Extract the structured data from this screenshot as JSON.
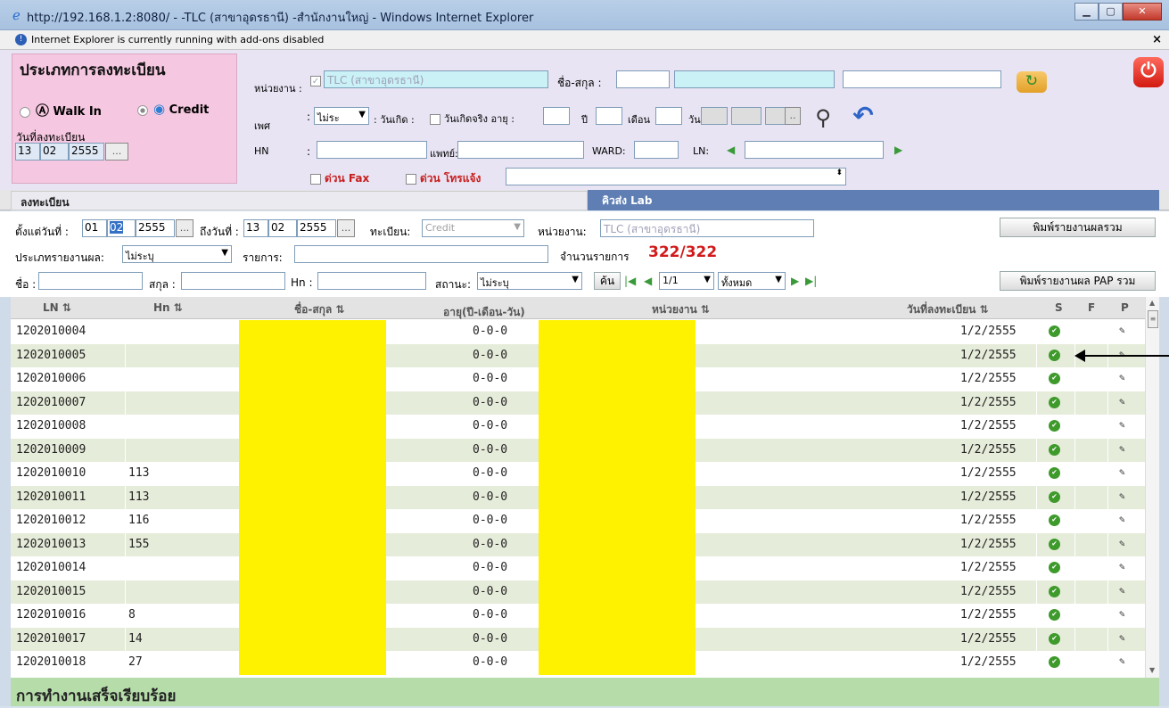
{
  "window": {
    "title": "http://192.168.1.2:8080/ - -TLC (สาขาอุดรธานี) -สำนักงานใหญ่ - Windows Internet Explorer",
    "addon_bar": "Internet Explorer is currently running with add-ons disabled",
    "close_label": "×"
  },
  "registration": {
    "legend": "ประเภทการลงทะเบียน",
    "walkin_label": "Walk In",
    "credit_label": "Credit",
    "date_label": "วันที่ลงทะเบียน",
    "date_day": "13",
    "date_month": "02",
    "date_year": "2555",
    "date_btn": "..."
  },
  "form": {
    "unit_label": "หน่วยงาน :",
    "unit_value": "TLC (สาขาอุดรธานี)",
    "name_label": "ชื่อ-สกุล :",
    "sex_label": "เพศ",
    "sex_value": "ไม่ระ",
    "birth_label": ": วันเกิด :",
    "realbirth_label": "วันเกิดจริง อายุ :",
    "year_label": "ปี",
    "month_label": "เดือน",
    "day_label": "วัน",
    "hn_label": "HN",
    "doctor_label": "แพทย์:",
    "ward_label": "WARD:",
    "ln_label": "LN:",
    "urgent_fax": "ด่วน Fax",
    "urgent_phone": "ด่วน โทรแจ้ง"
  },
  "tabs": {
    "register": "ลงทะเบียน",
    "queue": "คิวส่ง Lab"
  },
  "filters": {
    "from_label": "ตั้งแต่วันที่ :",
    "from_day": "01",
    "from_month": "02",
    "from_year": "2555",
    "to_label": "ถึงวันที่ :",
    "to_day": "13",
    "to_month": "02",
    "to_year": "2555",
    "regtype_label": "ทะเบียน:",
    "regtype_value": "Credit",
    "unit_label": "หน่วยงาน:",
    "unit_value": "TLC (สาขาอุดรธานี)",
    "print_summary": "พิมพ์รายงานผลรวม",
    "reporttype_label": "ประเภทรายงานผล:",
    "reporttype_value": "ไม่ระบุ",
    "items_label": "รายการ:",
    "count_label": "จำนวนรายการ",
    "count_value": "322/322",
    "name_label": "ชื่อ :",
    "surname_label": "สกุล :",
    "hn_label": "Hn :",
    "status_label": "สถานะ:",
    "status_value": "ไม่ระบุ",
    "search_btn": "ค้น",
    "page_value": "1/1",
    "all_value": "ทั้งหมด",
    "print_pap": "พิมพ์รายงานผล PAP รวม"
  },
  "grid": {
    "headers": {
      "ln": "LN",
      "hn": "Hn",
      "name": "ชื่อ-สกุล",
      "age": "อายุ(ปี-เดือน-วัน)",
      "unit": "หน่วยงาน",
      "date": "วันที่ลงทะเบียน",
      "s": "S",
      "f": "F",
      "p": "P"
    },
    "rows": [
      {
        "ln": "1202010004",
        "hn": "",
        "age": "0-0-0",
        "date": "1/2/2555"
      },
      {
        "ln": "1202010005",
        "hn": "",
        "age": "0-0-0",
        "date": "1/2/2555"
      },
      {
        "ln": "1202010006",
        "hn": "",
        "age": "0-0-0",
        "date": "1/2/2555"
      },
      {
        "ln": "1202010007",
        "hn": "",
        "age": "0-0-0",
        "date": "1/2/2555"
      },
      {
        "ln": "1202010008",
        "hn": "",
        "age": "0-0-0",
        "date": "1/2/2555"
      },
      {
        "ln": "1202010009",
        "hn": "",
        "age": "0-0-0",
        "date": "1/2/2555"
      },
      {
        "ln": "1202010010",
        "hn": "113",
        "age": "0-0-0",
        "date": "1/2/2555"
      },
      {
        "ln": "1202010011",
        "hn": "113",
        "age": "0-0-0",
        "date": "1/2/2555"
      },
      {
        "ln": "1202010012",
        "hn": "116",
        "age": "0-0-0",
        "date": "1/2/2555"
      },
      {
        "ln": "1202010013",
        "hn": "155",
        "age": "0-0-0",
        "date": "1/2/2555"
      },
      {
        "ln": "1202010014",
        "hn": "",
        "age": "0-0-0",
        "date": "1/2/2555"
      },
      {
        "ln": "1202010015",
        "hn": "",
        "age": "0-0-0",
        "date": "1/2/2555"
      },
      {
        "ln": "1202010016",
        "hn": "8",
        "age": "0-0-0",
        "date": "1/2/2555"
      },
      {
        "ln": "1202010017",
        "hn": "14",
        "age": "0-0-0",
        "date": "1/2/2555"
      },
      {
        "ln": "1202010018",
        "hn": "27",
        "age": "0-0-0",
        "date": "1/2/2555"
      }
    ]
  },
  "status_bar": "การทำงานเสร็จเรียบร้อย",
  "colors": {
    "highlight": "#fff200",
    "tab_active": "#5f7fb4",
    "status_bg": "#b6dcaa",
    "count": "#d21a1a"
  }
}
